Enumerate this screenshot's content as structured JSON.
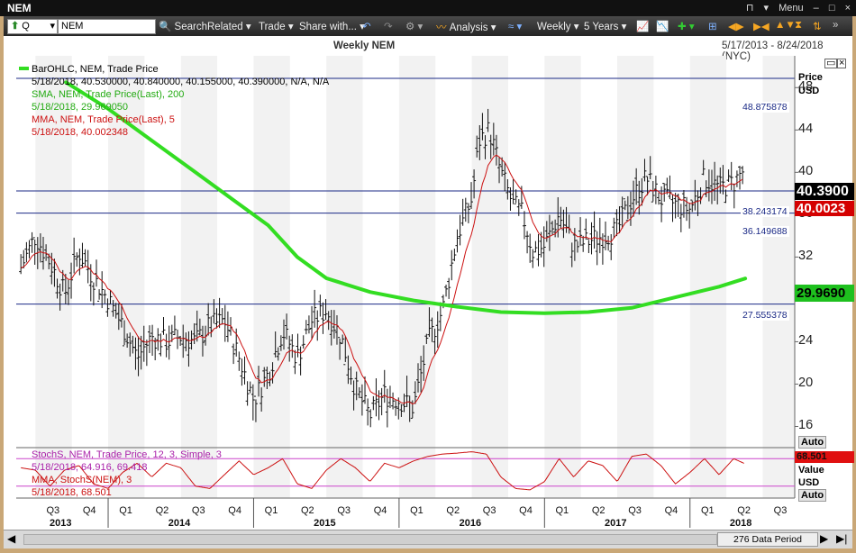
{
  "window": {
    "title": "NEM",
    "menu_label": "Menu"
  },
  "toolbar": {
    "symbol_type": "Q",
    "symbol_value": "NEM",
    "search": "Search",
    "related": "Related",
    "trade": "Trade",
    "share": "Share with...",
    "analysis": "Analysis",
    "frequency": "Weekly",
    "range": "5 Years"
  },
  "chart": {
    "title": "Weekly NEM",
    "date_range": "5/17/2013 - 8/24/2018 (NYC)",
    "price_axis_title": "Price",
    "price_axis_unit": "USD",
    "auto_label": "Auto",
    "value_axis_title": "Value",
    "value_axis_unit": "USD",
    "data_period": "276 Data Period"
  },
  "legend": {
    "bar_title": "BarOHLC, NEM, Trade Price",
    "bar_values": "5/18/2018, 40.530000, 40.840000, 40.155000, 40.390000, N/A, N/A",
    "sma_title": "SMA, NEM, Trade Price(Last), 200",
    "sma_value": "5/18/2018, 29.969050",
    "mma_title": "MMA, NEM, Trade Price(Last), 5",
    "mma_value": "5/18/2018, 40.002348",
    "stoch_title": "StochS, NEM, Trade Price, 12, 3, Simple, 3",
    "stoch_value": "5/18/2018, 64.916, 69.418",
    "stoch_mma_title": "MMA, StochS(NEM), 3",
    "stoch_mma_value": "5/18/2018, 68.501"
  },
  "levels": [
    "48.875878",
    "38.243174",
    "36.149688",
    "27.555378"
  ],
  "current": {
    "price": "40.3900",
    "mma": "40.0023",
    "sma": "29.9690",
    "stoch": "68.501"
  },
  "colors": {
    "sma": "#33dd22",
    "mma": "#cc1111",
    "level": "#1b2a86",
    "stoch_band": "#cc44cc"
  },
  "chart_data": {
    "type": "line",
    "title": "Weekly NEM",
    "ylabel": "Price USD",
    "ylim": [
      14,
      51
    ],
    "y_ticks": [
      "48",
      "44",
      "40",
      "36",
      "32",
      "28",
      "24",
      "20",
      "16"
    ],
    "quarters": [
      "Q3",
      "Q4",
      "Q1",
      "Q2",
      "Q3",
      "Q4",
      "Q1",
      "Q2",
      "Q3",
      "Q4",
      "Q1",
      "Q2",
      "Q3",
      "Q4",
      "Q1",
      "Q2",
      "Q3",
      "Q4",
      "Q1",
      "Q2",
      "Q3"
    ],
    "years": [
      "2013",
      "2014",
      "2015",
      "2016",
      "2017",
      "2018"
    ],
    "price_series": [
      {
        "x": 2013.4,
        "y": 31.0
      },
      {
        "x": 2013.5,
        "y": 34.0
      },
      {
        "x": 2013.6,
        "y": 31.5
      },
      {
        "x": 2013.7,
        "y": 28.5
      },
      {
        "x": 2013.8,
        "y": 32.5
      },
      {
        "x": 2013.9,
        "y": 30.0
      },
      {
        "x": 2014.0,
        "y": 28.0
      },
      {
        "x": 2014.1,
        "y": 25.5
      },
      {
        "x": 2014.2,
        "y": 22.5
      },
      {
        "x": 2014.3,
        "y": 24.5
      },
      {
        "x": 2014.4,
        "y": 24.0
      },
      {
        "x": 2014.5,
        "y": 24.5
      },
      {
        "x": 2014.6,
        "y": 24.0
      },
      {
        "x": 2014.7,
        "y": 25.5
      },
      {
        "x": 2014.8,
        "y": 26.0
      },
      {
        "x": 2014.9,
        "y": 22.5
      },
      {
        "x": 2015.0,
        "y": 18.5
      },
      {
        "x": 2015.1,
        "y": 21.0
      },
      {
        "x": 2015.2,
        "y": 25.0
      },
      {
        "x": 2015.3,
        "y": 22.5
      },
      {
        "x": 2015.4,
        "y": 26.0
      },
      {
        "x": 2015.5,
        "y": 27.0
      },
      {
        "x": 2015.6,
        "y": 24.5
      },
      {
        "x": 2015.7,
        "y": 19.5
      },
      {
        "x": 2015.8,
        "y": 17.0
      },
      {
        "x": 2015.9,
        "y": 19.0
      },
      {
        "x": 2016.0,
        "y": 18.5
      },
      {
        "x": 2016.1,
        "y": 17.8
      },
      {
        "x": 2016.2,
        "y": 24.0
      },
      {
        "x": 2016.3,
        "y": 27.0
      },
      {
        "x": 2016.4,
        "y": 34.0
      },
      {
        "x": 2016.5,
        "y": 37.5
      },
      {
        "x": 2016.55,
        "y": 43.0
      },
      {
        "x": 2016.62,
        "y": 44.0
      },
      {
        "x": 2016.7,
        "y": 40.0
      },
      {
        "x": 2016.78,
        "y": 37.0
      },
      {
        "x": 2016.85,
        "y": 36.0
      },
      {
        "x": 2016.92,
        "y": 32.5
      },
      {
        "x": 2017.0,
        "y": 33.0
      },
      {
        "x": 2017.1,
        "y": 36.0
      },
      {
        "x": 2017.2,
        "y": 33.0
      },
      {
        "x": 2017.3,
        "y": 33.5
      },
      {
        "x": 2017.4,
        "y": 34.0
      },
      {
        "x": 2017.5,
        "y": 34.5
      },
      {
        "x": 2017.6,
        "y": 37.5
      },
      {
        "x": 2017.7,
        "y": 39.5
      },
      {
        "x": 2017.8,
        "y": 37.5
      },
      {
        "x": 2017.9,
        "y": 37.0
      },
      {
        "x": 2018.0,
        "y": 36.5
      },
      {
        "x": 2018.1,
        "y": 39.5
      },
      {
        "x": 2018.2,
        "y": 38.5
      },
      {
        "x": 2018.3,
        "y": 39.0
      },
      {
        "x": 2018.38,
        "y": 40.39
      }
    ],
    "sma_series": [
      {
        "x": 2013.71,
        "y": 48.5
      },
      {
        "x": 2014.0,
        "y": 46.0
      },
      {
        "x": 2014.3,
        "y": 43.0
      },
      {
        "x": 2014.6,
        "y": 40.0
      },
      {
        "x": 2014.85,
        "y": 37.5
      },
      {
        "x": 2015.1,
        "y": 35.0
      },
      {
        "x": 2015.3,
        "y": 32.0
      },
      {
        "x": 2015.5,
        "y": 30.0
      },
      {
        "x": 2015.8,
        "y": 28.7
      },
      {
        "x": 2016.1,
        "y": 27.9
      },
      {
        "x": 2016.4,
        "y": 27.3
      },
      {
        "x": 2016.7,
        "y": 26.8
      },
      {
        "x": 2017.0,
        "y": 26.7
      },
      {
        "x": 2017.3,
        "y": 26.8
      },
      {
        "x": 2017.6,
        "y": 27.2
      },
      {
        "x": 2017.9,
        "y": 28.2
      },
      {
        "x": 2018.2,
        "y": 29.2
      },
      {
        "x": 2018.38,
        "y": 29.97
      }
    ],
    "stoch_series": [
      {
        "x": 2013.4,
        "y": 60
      },
      {
        "x": 2013.5,
        "y": 55
      },
      {
        "x": 2013.6,
        "y": 20
      },
      {
        "x": 2013.7,
        "y": 55
      },
      {
        "x": 2013.8,
        "y": 65
      },
      {
        "x": 2013.9,
        "y": 25
      },
      {
        "x": 2014.0,
        "y": 15
      },
      {
        "x": 2014.1,
        "y": 50
      },
      {
        "x": 2014.2,
        "y": 70
      },
      {
        "x": 2014.3,
        "y": 40
      },
      {
        "x": 2014.4,
        "y": 70
      },
      {
        "x": 2014.5,
        "y": 60
      },
      {
        "x": 2014.6,
        "y": 20
      },
      {
        "x": 2014.7,
        "y": 15
      },
      {
        "x": 2014.8,
        "y": 45
      },
      {
        "x": 2014.9,
        "y": 75
      },
      {
        "x": 2015.0,
        "y": 45
      },
      {
        "x": 2015.1,
        "y": 60
      },
      {
        "x": 2015.2,
        "y": 80
      },
      {
        "x": 2015.3,
        "y": 25
      },
      {
        "x": 2015.4,
        "y": 15
      },
      {
        "x": 2015.5,
        "y": 55
      },
      {
        "x": 2015.6,
        "y": 80
      },
      {
        "x": 2015.7,
        "y": 60
      },
      {
        "x": 2015.8,
        "y": 30
      },
      {
        "x": 2015.9,
        "y": 70
      },
      {
        "x": 2016.0,
        "y": 60
      },
      {
        "x": 2016.1,
        "y": 75
      },
      {
        "x": 2016.2,
        "y": 85
      },
      {
        "x": 2016.3,
        "y": 90
      },
      {
        "x": 2016.4,
        "y": 92
      },
      {
        "x": 2016.5,
        "y": 95
      },
      {
        "x": 2016.6,
        "y": 90
      },
      {
        "x": 2016.7,
        "y": 40
      },
      {
        "x": 2016.8,
        "y": 15
      },
      {
        "x": 2016.9,
        "y": 12
      },
      {
        "x": 2017.0,
        "y": 30
      },
      {
        "x": 2017.1,
        "y": 80
      },
      {
        "x": 2017.2,
        "y": 40
      },
      {
        "x": 2017.3,
        "y": 75
      },
      {
        "x": 2017.4,
        "y": 65
      },
      {
        "x": 2017.5,
        "y": 30
      },
      {
        "x": 2017.6,
        "y": 85
      },
      {
        "x": 2017.7,
        "y": 90
      },
      {
        "x": 2017.8,
        "y": 65
      },
      {
        "x": 2017.9,
        "y": 25
      },
      {
        "x": 2018.0,
        "y": 50
      },
      {
        "x": 2018.1,
        "y": 80
      },
      {
        "x": 2018.2,
        "y": 45
      },
      {
        "x": 2018.3,
        "y": 80
      },
      {
        "x": 2018.38,
        "y": 68.5
      }
    ]
  }
}
